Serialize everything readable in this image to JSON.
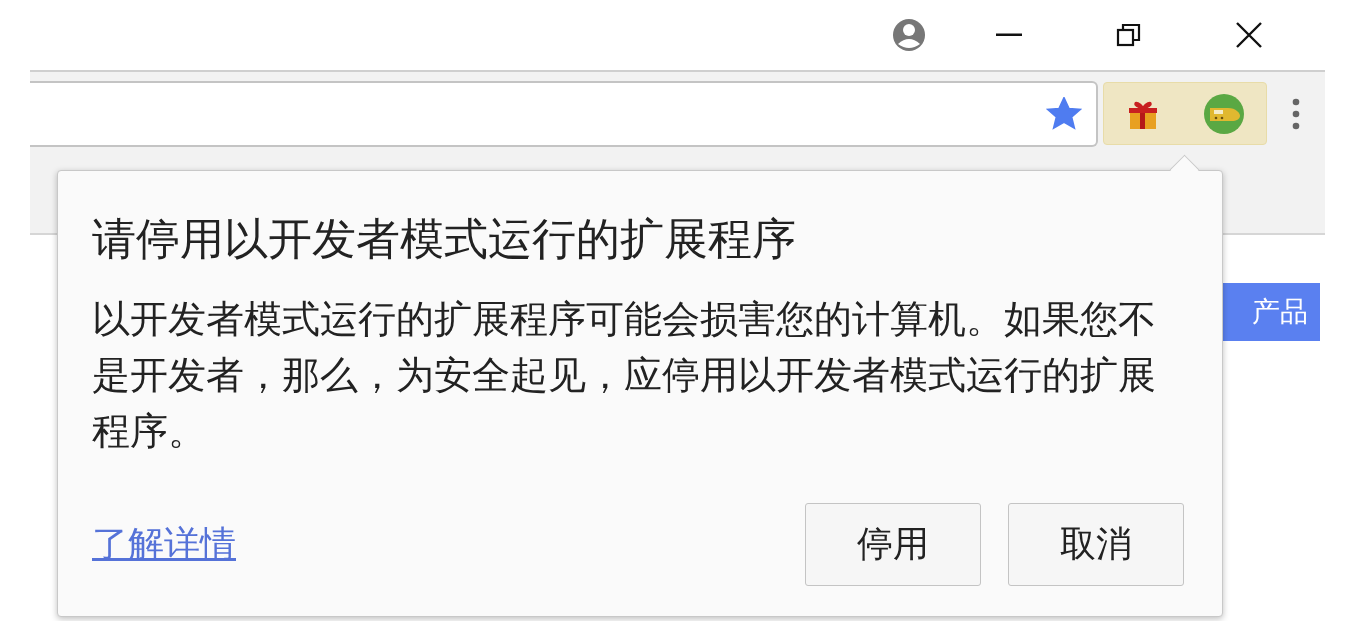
{
  "address_bar": {
    "bookmarked": true
  },
  "page": {
    "button": "产品"
  },
  "dialog": {
    "title": "请停用以开发者模式运行的扩展程序",
    "message": "以开发者模式运行的扩展程序可能会损害您的计算机。如果您不是开发者，那么，为安全起见，应停用以开发者模式运行的扩展程序。",
    "link": "了解详情",
    "buttons": [
      "停用",
      "取消"
    ]
  }
}
